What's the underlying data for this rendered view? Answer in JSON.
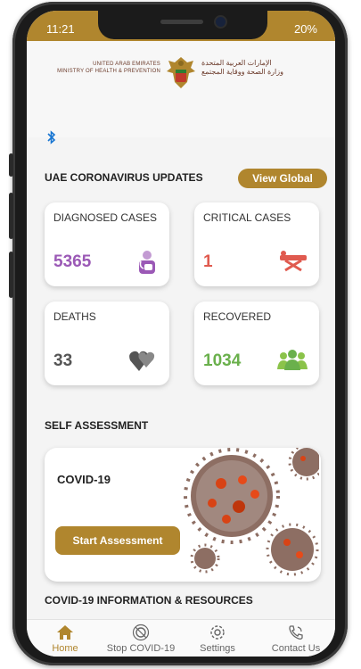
{
  "status_bar": {
    "time": "11:21",
    "battery": "20%"
  },
  "ministry": {
    "english_line1": "UNITED ARAB EMIRATES",
    "english_line2": "MINISTRY OF HEALTH & PREVENTION",
    "arabic_line1": "الإمارات العربية المتحدة",
    "arabic_line2": "وزارة الصحة ووقاية المجتمع"
  },
  "updates": {
    "title": "UAE CORONAVIRUS UPDATES",
    "view_global_label": "View Global"
  },
  "stats": [
    {
      "label": "DIAGNOSED CASES",
      "value": "5365",
      "color": "#9b59b6",
      "icon": "patient-icon"
    },
    {
      "label": "CRITICAL CASES",
      "value": "1",
      "color": "#e05a4f",
      "icon": "stretcher-icon"
    },
    {
      "label": "DEATHS",
      "value": "33",
      "color": "#555555",
      "icon": "broken-heart-icon"
    },
    {
      "label": "RECOVERED",
      "value": "1034",
      "color": "#6ab04c",
      "icon": "people-icon"
    }
  ],
  "self_assessment": {
    "title": "SELF ASSESSMENT",
    "card_title": "COVID-19",
    "button_label": "Start Assessment"
  },
  "resources": {
    "title": "COVID-19 INFORMATION & RESOURCES"
  },
  "bottom_nav": [
    {
      "label": "Home",
      "icon": "home-icon",
      "active": true
    },
    {
      "label": "Stop COVID-19",
      "icon": "virus-icon",
      "active": false
    },
    {
      "label": "Settings",
      "icon": "gear-icon",
      "active": false
    },
    {
      "label": "Contact Us",
      "icon": "phone-icon",
      "active": false
    }
  ],
  "colors": {
    "accent": "#b0862e"
  }
}
